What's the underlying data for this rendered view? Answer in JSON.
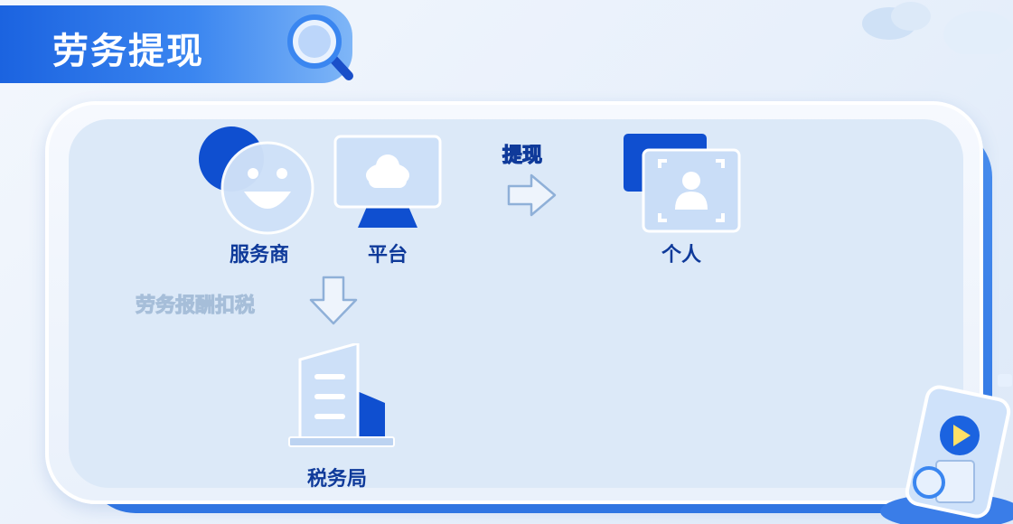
{
  "title": "劳务提现",
  "nodes": {
    "service_provider": "服务商",
    "platform": "平台",
    "individual": "个人",
    "tax_bureau": "税务局"
  },
  "arrows": {
    "withdraw": "提现",
    "tax_withholding": "劳务报酬扣税"
  },
  "colors": {
    "accent": "#1b63e0",
    "dark_blue": "#0f3a9a",
    "panel_bg": "#dce9f8"
  }
}
